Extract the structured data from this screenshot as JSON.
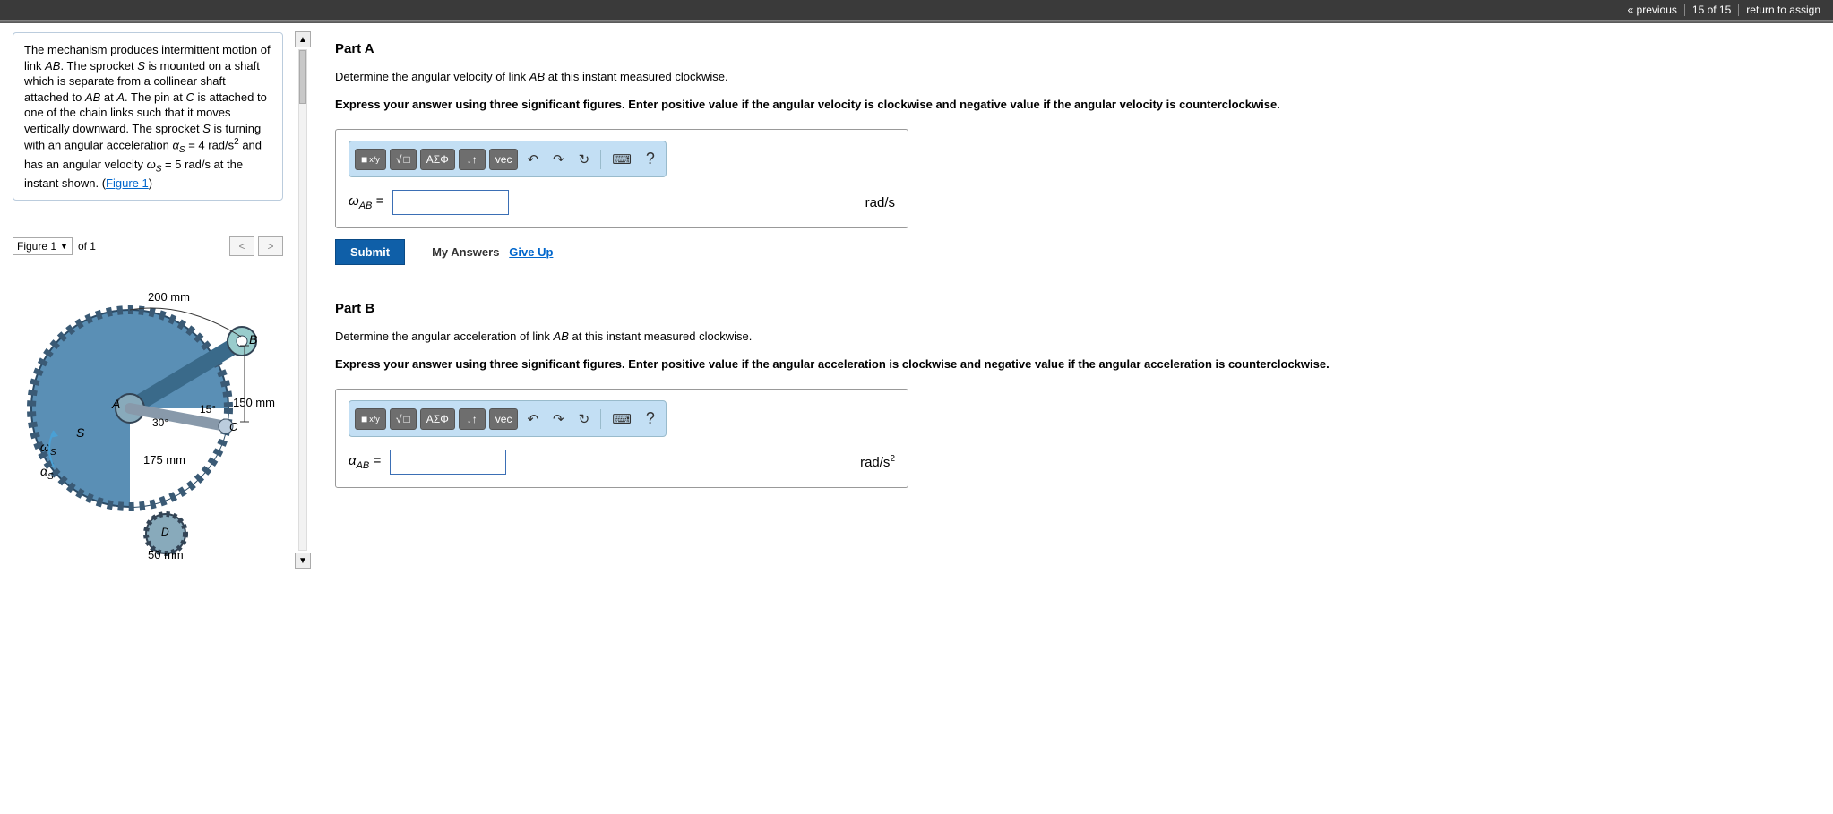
{
  "topbar": {
    "prev": "« previous",
    "counter": "15 of 15",
    "return": "return to assign"
  },
  "problem": {
    "text_pre": "The mechanism produces intermittent motion of link ",
    "AB": "AB",
    "text2": ". The sprocket ",
    "S": "S",
    "text3": " is mounted on a shaft which is separate from a collinear shaft attached to ",
    "text4": " at ",
    "A": "A",
    "text5": ". The pin at ",
    "C": "C",
    "text6": " is attached to one of the chain links such that it moves vertically downward. The sprocket ",
    "text7": " is turning with an angular acceleration ",
    "alpha_s": "α",
    "alpha_sub": "S",
    "eq1": " = 4  rad/s",
    "sq": "2",
    "text8": " and has an angular velocity ",
    "omega_s": "ω",
    "eq2": " = 5  rad/s at the instant shown. (",
    "fig_link": "Figure 1",
    "close": ")"
  },
  "figure": {
    "select_label": "Figure 1",
    "of": "of 1",
    "labels": {
      "d200": "200 mm",
      "d150": "150 mm",
      "d175": "175 mm",
      "d50": "50 mm",
      "a30": "30°",
      "a15": "15°",
      "A": "A",
      "B": "B",
      "C": "C",
      "D": "D",
      "S": "S",
      "ws": "ω",
      "as": "α",
      "wsub": "S",
      "asub": "S"
    }
  },
  "partA": {
    "title": "Part A",
    "prompt_pre": "Determine the angular velocity of link ",
    "AB": "AB",
    "prompt_post": " at this instant measured clockwise.",
    "instr": "Express your answer using three significant figures. Enter positive value if the angular velocity is clockwise and negative value if the angular velocity is counterclockwise.",
    "var": "ω",
    "varsub": "AB",
    "eq": " = ",
    "unit": "rad/s"
  },
  "partB": {
    "title": "Part B",
    "prompt_pre": "Determine the angular acceleration of link ",
    "AB": "AB",
    "prompt_post": " at this instant measured clockwise.",
    "instr": "Express your answer using three significant figures. Enter positive value if the angular acceleration is clockwise and negative value if the angular acceleration is counterclockwise.",
    "var": "α",
    "varsub": "AB",
    "eq": " = ",
    "unit_pre": "rad/s",
    "unit_sup": "2"
  },
  "toolbar": {
    "template": "■",
    "sqrt": "√",
    "box": "□",
    "greek": "ΑΣΦ",
    "updown": "↓↑",
    "vec": "vec",
    "undo": "↶",
    "redo": "↷",
    "reset": "↻",
    "kbd": "⌨",
    "help": "?"
  },
  "buttons": {
    "submit": "Submit",
    "myanswers": "My Answers",
    "giveup": "Give Up"
  }
}
